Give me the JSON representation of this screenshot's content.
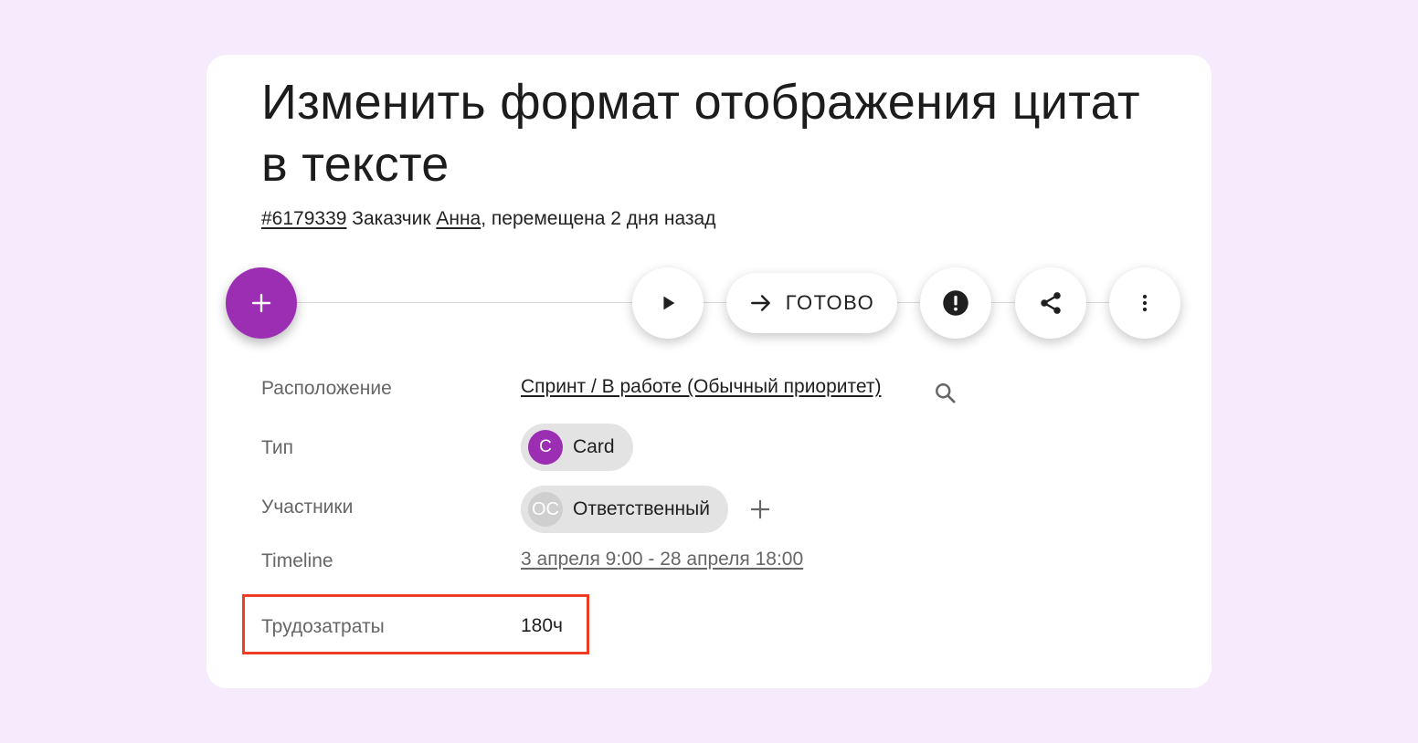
{
  "task": {
    "title": "Изменить формат отображения цитат в тексте",
    "id_link": "#6179339",
    "customer_prefix": " Заказчик ",
    "customer_name": "Анна",
    "moved_text": ", перемещена 2 дня назад"
  },
  "toolbar": {
    "add_icon": "plus-icon",
    "play_icon": "play-icon",
    "done_icon": "arrow-right-icon",
    "done_label": "ГОТОВО",
    "alert_icon": "exclamation-circle-icon",
    "share_icon": "share-icon",
    "more_icon": "more-vertical-icon"
  },
  "fields": {
    "location_label": "Расположение",
    "location_value": "Спринт / В работе (Обычный приоритет)",
    "type_label": "Тип",
    "type_avatar": "C",
    "type_value": "Card",
    "members_label": "Участники",
    "member_avatar": "ОС",
    "member_value": "Ответственный",
    "timeline_label": "Timeline",
    "timeline_value": "3 апреля 9:00 - 28 апреля 18:00",
    "effort_label": "Трудозатраты",
    "effort_value": "180ч"
  },
  "colors": {
    "background": "#f5ebfd",
    "accent": "#9c2eb3",
    "highlight": "#ef3d24",
    "member_avatar": "#cfcfcf"
  }
}
